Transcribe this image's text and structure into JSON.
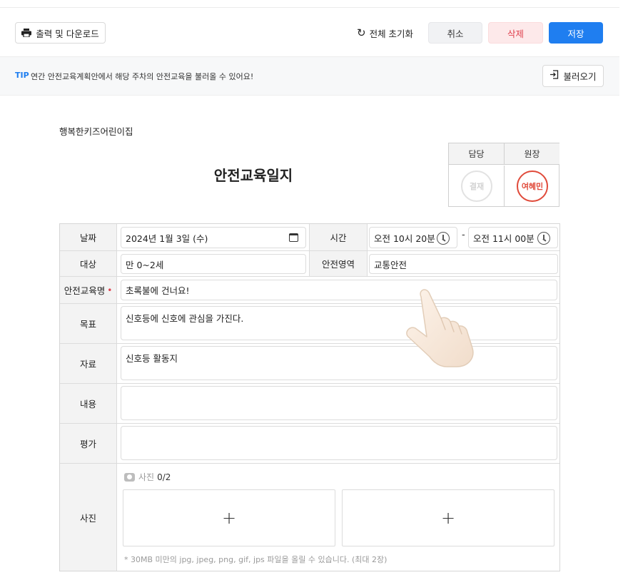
{
  "toolbar": {
    "print_label": "출력 및 다운로드",
    "reset_label": "전체 초기화",
    "cancel_label": "취소",
    "delete_label": "삭제",
    "save_label": "저장"
  },
  "tip": {
    "label": "TIP",
    "text": "연간 안전교육계획안에서 해당 주차의 안전교육을 불러올 수 있어요!",
    "load_label": "불러오기"
  },
  "document": {
    "org_name": "행복한키즈어린이집",
    "title": "안전교육일지"
  },
  "approval": {
    "col1_label": "담당",
    "col2_label": "원장",
    "col1_stamp": "결재",
    "col2_stamp": "여혜민"
  },
  "form": {
    "date_label": "날짜",
    "date_value": "2024년 1월 3일 (수)",
    "time_label": "시간",
    "time_start": "오전 10시 20분",
    "time_end": "오전 11시 00분",
    "target_label": "대상",
    "target_value": "만 0~2세",
    "area_label": "안전영역",
    "area_value": "교통안전",
    "name_label": "안전교육명",
    "name_value": "초록불에 건너요!",
    "goal_label": "목표",
    "goal_value": "신호등에 신호에 관심을 가진다.",
    "material_label": "자료",
    "material_value": "신호등 활동지",
    "content_label": "내용",
    "content_value": "",
    "eval_label": "평가",
    "eval_value": "",
    "photo_label": "사진",
    "photo_sub": "사진",
    "photo_count": "0/2",
    "photo_note": "* 30MB 미만의 jpg, jpeg, png, gif, jps 파일을 올릴 수 있습니다. (최대 2장)",
    "plus": "+"
  },
  "colors": {
    "primary": "#1f7ef0",
    "danger": "#e0424f",
    "stamp": "#e04a3a"
  }
}
